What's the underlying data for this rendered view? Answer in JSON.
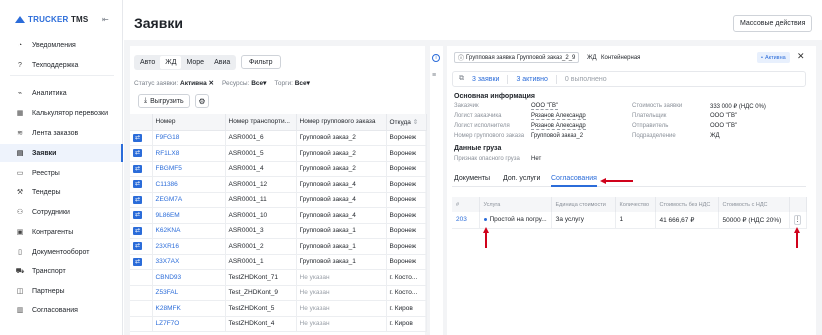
{
  "brand": {
    "name_prefix": "TRUCKER",
    "name_suffix": " TMS"
  },
  "sidebar": {
    "items": [
      {
        "label": "Уведомления",
        "icon": "bell-icon",
        "glyph": "◔"
      },
      {
        "label": "Техподдержка",
        "icon": "help-icon",
        "glyph": "?"
      },
      {
        "label": "Аналитика",
        "icon": "analytics-icon",
        "glyph": "⌁"
      },
      {
        "label": "Калькулятор перевозки",
        "icon": "calculator-icon",
        "glyph": "▦"
      },
      {
        "label": "Лента заказов",
        "icon": "feed-icon",
        "glyph": "≋"
      },
      {
        "label": "Заявки",
        "icon": "orders-icon",
        "glyph": "▤"
      },
      {
        "label": "Реестры",
        "icon": "registry-icon",
        "glyph": "▭"
      },
      {
        "label": "Тендеры",
        "icon": "tender-icon",
        "glyph": "⚒"
      },
      {
        "label": "Сотрудники",
        "icon": "user-icon",
        "glyph": "⚇"
      },
      {
        "label": "Контрагенты",
        "icon": "partners-icon",
        "glyph": "▣"
      },
      {
        "label": "Документооборот",
        "icon": "document-icon",
        "glyph": "▯"
      },
      {
        "label": "Транспорт",
        "icon": "truck-icon",
        "glyph": "⛟"
      },
      {
        "label": "Партнеры",
        "icon": "handshake-icon",
        "glyph": "◫"
      },
      {
        "label": "Согласования",
        "icon": "approval-icon",
        "glyph": "▥"
      }
    ],
    "active_index": 5
  },
  "header": {
    "title": "Заявки",
    "mass_actions": "Массовые действия"
  },
  "list": {
    "modes": [
      "Авто",
      "ЖД",
      "Море",
      "Авиа"
    ],
    "active_mode": 1,
    "filter_label": "Фильтр",
    "status_prefix": "Статус заявки:",
    "status_value": "Активна",
    "resources_prefix": "Ресурсы:",
    "resources_value": "Все",
    "trades_prefix": "Торги:",
    "trades_value": "Все",
    "export_label": "Выгрузить",
    "columns": [
      "Номер",
      "Номер транспорти...",
      "Номер группового заказа",
      "Откуда"
    ],
    "rows": [
      {
        "num": "F9FG18",
        "transport": "ASR0001_6",
        "group": "Групповой заказ_2",
        "from": "Воронеж",
        "icon": true
      },
      {
        "num": "RF1LX8",
        "transport": "ASR0001_5",
        "group": "Групповой заказ_2",
        "from": "Воронеж",
        "icon": true
      },
      {
        "num": "FBGMF5",
        "transport": "ASR0001_4",
        "group": "Групповой заказ_2",
        "from": "Воронеж",
        "icon": true
      },
      {
        "num": "C11386",
        "transport": "ASR0001_12",
        "group": "Групповой заказ_4",
        "from": "Воронеж",
        "icon": true
      },
      {
        "num": "ZEGM7A",
        "transport": "ASR0001_11",
        "group": "Групповой заказ_4",
        "from": "Воронеж",
        "icon": true
      },
      {
        "num": "9L86EM",
        "transport": "ASR0001_10",
        "group": "Групповой заказ_4",
        "from": "Воронеж",
        "icon": true
      },
      {
        "num": "K62KNA",
        "transport": "ASR0001_3",
        "group": "Групповой заказ_1",
        "from": "Воронеж",
        "icon": true
      },
      {
        "num": "23XR16",
        "transport": "ASR0001_2",
        "group": "Групповой заказ_1",
        "from": "Воронеж",
        "icon": true
      },
      {
        "num": "33X7AX",
        "transport": "ASR0001_1",
        "group": "Групповой заказ_1",
        "from": "Воронеж",
        "icon": true
      },
      {
        "num": "CBND93",
        "transport": "TestZHDKont_71",
        "group": "Не указан",
        "from": "г. Косто...",
        "icon": false
      },
      {
        "num": "Z53FAL",
        "transport": "Test_ZHDKont_9",
        "group": "Не указан",
        "from": "г. Косто...",
        "icon": false
      },
      {
        "num": "K28MFK",
        "transport": "TestZHDKont_5",
        "group": "Не указан",
        "from": "г. Киров",
        "icon": false
      },
      {
        "num": "LZ7F7O",
        "transport": "TestZHDKont_4",
        "group": "Не указан",
        "from": "г. Киров",
        "icon": false
      }
    ]
  },
  "detail": {
    "group_chip": "Групповая заявка Групповой заказ_2_9",
    "mode_chip": "ЖД",
    "container_chip": "Контейнерная",
    "status_badge": "Активна",
    "counters": {
      "orders": "3 заявки",
      "active": "3 активно",
      "done": "0 выполнено"
    },
    "main_info_title": "Основная информация",
    "left_fields": [
      {
        "k": "Заказчик",
        "v": "ООО \"ГВ\"",
        "underline": true
      },
      {
        "k": "Логист заказчика",
        "v": "Рязанов Александр",
        "underline": true
      },
      {
        "k": "Логист исполнителя",
        "v": "Рязанов Александр",
        "underline": true
      },
      {
        "k": "Номер группового заказа",
        "v": "Групповой заказ_2",
        "underline": false
      }
    ],
    "right_fields": [
      {
        "k": "Стоимость заявки",
        "v": "333 000 ₽ (НДС 0%)"
      },
      {
        "k": "Плательщик",
        "v": "ООО \"ГВ\""
      },
      {
        "k": "Отправитель",
        "v": "ООО \"ГВ\""
      },
      {
        "k": "Подразделение",
        "v": "ЖД"
      }
    ],
    "cargo_title": "Данные груза",
    "cargo_field": {
      "k": "Признак опасного груза",
      "v": "Нет"
    },
    "tabs": [
      "Документы",
      "Доп. услуги",
      "Согласования"
    ],
    "active_tab": 2,
    "approvals": {
      "columns": [
        "#",
        "Услуга",
        "Единица стоимости",
        "Количество",
        "Стоимость без НДС",
        "Стоимость с НДС",
        ""
      ],
      "rows": [
        {
          "id": "203",
          "service": "Простой на погру...",
          "unit": "За услугу",
          "qty": "1",
          "net": "41 666,67 ₽",
          "gross": "50000 ₽ (НДС 20%)"
        }
      ]
    }
  }
}
